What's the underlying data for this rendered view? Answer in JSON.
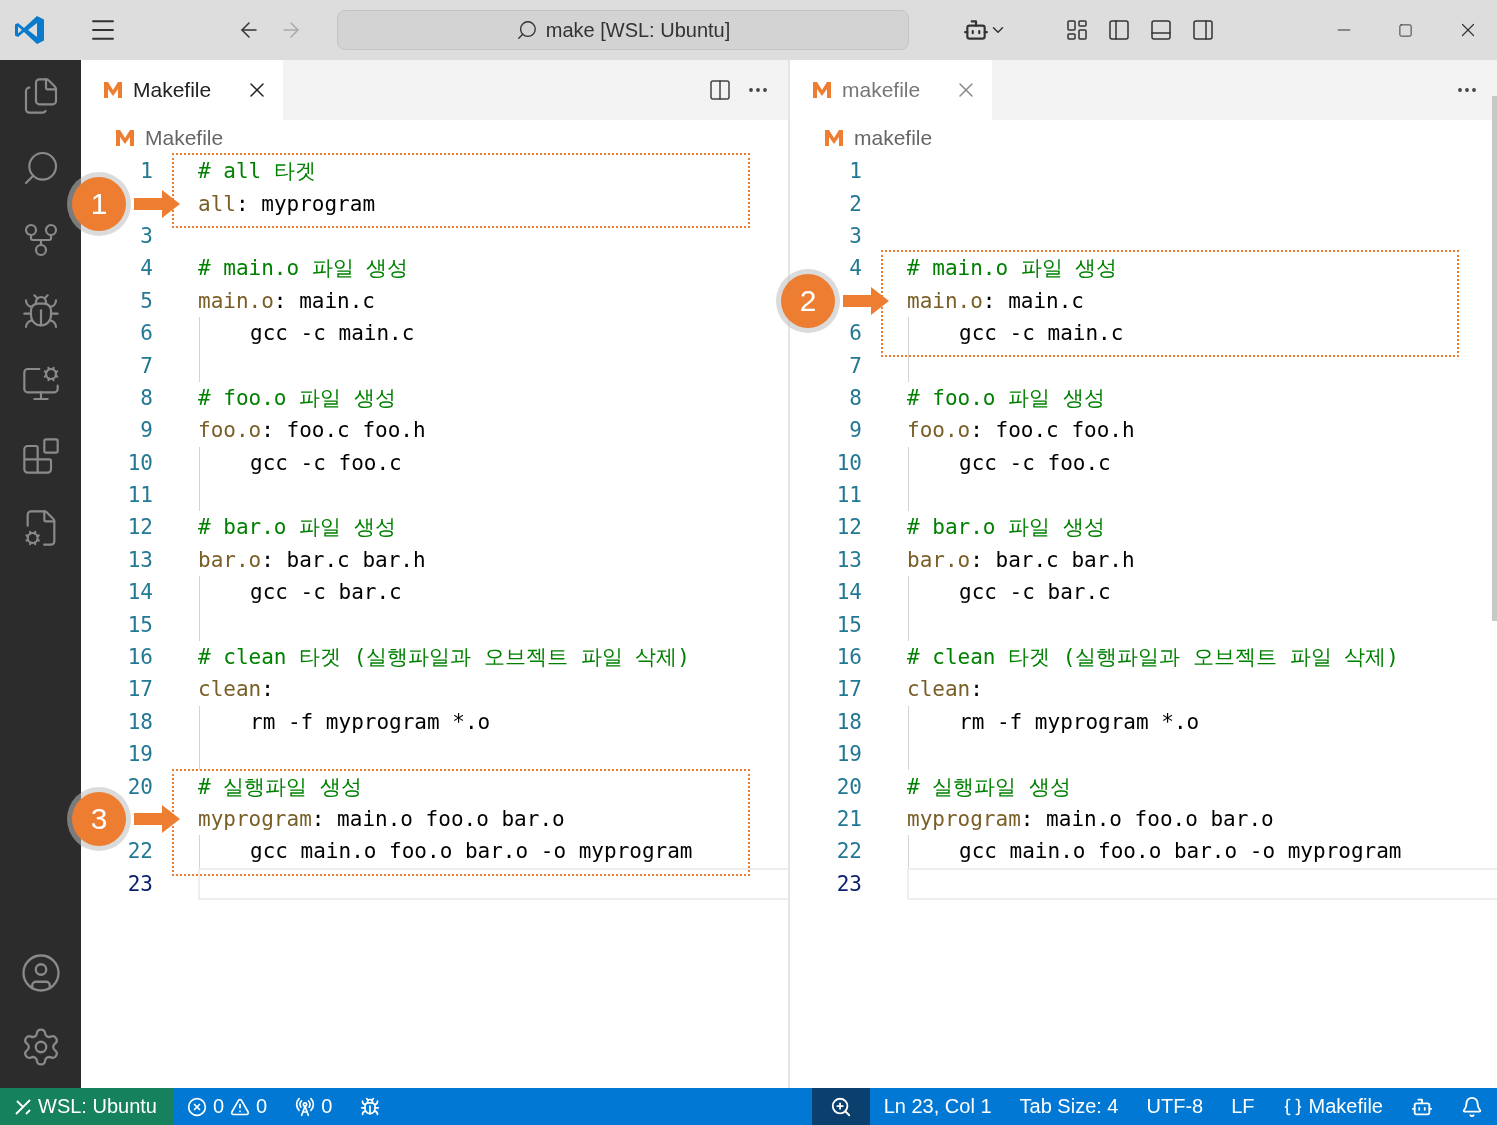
{
  "window": {
    "title": "make [WSL: Ubuntu]"
  },
  "panes": [
    {
      "focused": true,
      "tabs": [
        {
          "label": "Makefile",
          "selected": true
        }
      ],
      "breadcrumb": "Makefile",
      "split_button": true,
      "lines": [
        {
          "n": "1",
          "kind": "comment",
          "text": "# all 타겟",
          "boxed": true,
          "current": false
        },
        {
          "kind": "rule",
          "target": "all",
          "sep": ":",
          "deps": " myprogram",
          "boxed": true,
          "current": false,
          "marker": "1"
        },
        {
          "n": "3",
          "kind": "blank",
          "boxed": false,
          "current": false
        },
        {
          "n": "4",
          "kind": "comment",
          "text": "# main.o 파일 생성",
          "boxed": false,
          "current": false
        },
        {
          "n": "5",
          "kind": "rule",
          "target": "main.o",
          "sep": ":",
          "deps": " main.c",
          "boxed": false,
          "current": false
        },
        {
          "n": "6",
          "kind": "recipe",
          "text": "gcc -c main.c",
          "boxed": false,
          "current": false
        },
        {
          "n": "7",
          "kind": "blank",
          "boxed": false,
          "current": false
        },
        {
          "n": "8",
          "kind": "comment",
          "text": "# foo.o 파일 생성",
          "boxed": false,
          "current": false
        },
        {
          "n": "9",
          "kind": "rule",
          "target": "foo.o",
          "sep": ":",
          "deps": " foo.c foo.h",
          "boxed": false,
          "current": false
        },
        {
          "n": "10",
          "kind": "recipe",
          "text": "gcc -c foo.c",
          "boxed": false,
          "current": false
        },
        {
          "n": "11",
          "kind": "blank",
          "boxed": false,
          "current": false
        },
        {
          "n": "12",
          "kind": "comment",
          "text": "# bar.o 파일 생성",
          "boxed": false,
          "current": false
        },
        {
          "n": "13",
          "kind": "rule",
          "target": "bar.o",
          "sep": ":",
          "deps": " bar.c bar.h",
          "boxed": false,
          "current": false
        },
        {
          "n": "14",
          "kind": "recipe",
          "text": "gcc -c bar.c",
          "boxed": false,
          "current": false
        },
        {
          "n": "15",
          "kind": "blank",
          "boxed": false,
          "current": false
        },
        {
          "n": "16",
          "kind": "comment",
          "text": "# clean 타겟 (실행파일과 오브젝트 파일 삭제)",
          "boxed": false,
          "current": false
        },
        {
          "n": "17",
          "kind": "rule",
          "target": "clean",
          "sep": ":",
          "boxed": false,
          "current": false
        },
        {
          "n": "18",
          "kind": "recipe",
          "text": "rm -f myprogram *.o",
          "boxed": false,
          "current": false
        },
        {
          "n": "19",
          "kind": "blank",
          "boxed": false,
          "current": false
        },
        {
          "n": "20",
          "kind": "comment",
          "text": "# 실행파일 생성",
          "boxed": true,
          "current": false
        },
        {
          "kind": "rule",
          "target": "myprogram",
          "sep": ":",
          "deps": " main.o foo.o bar.o",
          "boxed": true,
          "current": false,
          "marker": "3"
        },
        {
          "n": "22",
          "kind": "recipe",
          "text": "gcc main.o foo.o bar.o -o myprogram",
          "boxed": true,
          "current": false
        },
        {
          "n": "23",
          "kind": "blank",
          "boxed": false,
          "current": true
        }
      ]
    },
    {
      "focused": false,
      "tabs": [
        {
          "label": "makefile",
          "selected": true
        }
      ],
      "breadcrumb": "makefile",
      "split_button": false,
      "lines": [
        {
          "n": "1",
          "kind": "blank",
          "boxed": false,
          "current": false
        },
        {
          "n": "2",
          "kind": "blank",
          "boxed": false,
          "current": false
        },
        {
          "n": "3",
          "kind": "blank",
          "boxed": false,
          "current": false
        },
        {
          "n": "4",
          "kind": "comment",
          "text": "# main.o 파일 생성",
          "boxed": true,
          "current": false
        },
        {
          "kind": "rule",
          "target": "main.o",
          "sep": ":",
          "deps": " main.c",
          "boxed": true,
          "current": false,
          "marker": "2"
        },
        {
          "n": "6",
          "kind": "recipe",
          "text": "gcc -c main.c",
          "boxed": true,
          "current": false
        },
        {
          "n": "7",
          "kind": "blank",
          "boxed": false,
          "current": false
        },
        {
          "n": "8",
          "kind": "comment",
          "text": "# foo.o 파일 생성",
          "boxed": false,
          "current": false
        },
        {
          "n": "9",
          "kind": "rule",
          "target": "foo.o",
          "sep": ":",
          "deps": " foo.c foo.h",
          "boxed": false,
          "current": false
        },
        {
          "n": "10",
          "kind": "recipe",
          "text": "gcc -c foo.c",
          "boxed": false,
          "current": false
        },
        {
          "n": "11",
          "kind": "blank",
          "boxed": false,
          "current": false
        },
        {
          "n": "12",
          "kind": "comment",
          "text": "# bar.o 파일 생성",
          "boxed": false,
          "current": false
        },
        {
          "n": "13",
          "kind": "rule",
          "target": "bar.o",
          "sep": ":",
          "deps": " bar.c bar.h",
          "boxed": false,
          "current": false
        },
        {
          "n": "14",
          "kind": "recipe",
          "text": "gcc -c bar.c",
          "boxed": false,
          "current": false
        },
        {
          "n": "15",
          "kind": "blank",
          "boxed": false,
          "current": false
        },
        {
          "n": "16",
          "kind": "comment",
          "text": "# clean 타겟 (실행파일과 오브젝트 파일 삭제)",
          "boxed": false,
          "current": false
        },
        {
          "n": "17",
          "kind": "rule",
          "target": "clean",
          "sep": ":",
          "boxed": false,
          "current": false
        },
        {
          "n": "18",
          "kind": "recipe",
          "text": "rm -f myprogram *.o",
          "boxed": false,
          "current": false
        },
        {
          "n": "19",
          "kind": "blank",
          "boxed": false,
          "current": false
        },
        {
          "n": "20",
          "kind": "comment",
          "text": "# 실행파일 생성",
          "boxed": false,
          "current": false
        },
        {
          "n": "21",
          "kind": "rule",
          "target": "myprogram",
          "sep": ":",
          "deps": " main.o foo.o bar.o",
          "boxed": false,
          "current": false
        },
        {
          "n": "22",
          "kind": "recipe",
          "text": "gcc main.o foo.o bar.o -o myprogram",
          "boxed": false,
          "current": false
        },
        {
          "n": "23",
          "kind": "blank",
          "boxed": false,
          "current": true
        }
      ]
    }
  ],
  "status_bar": {
    "left": [
      {
        "kind": "remote",
        "text": "WSL: Ubuntu"
      },
      {
        "kind": "problems",
        "errors": "0",
        "warnings": "0"
      },
      {
        "kind": "ports",
        "text": "0"
      },
      {
        "kind": "debug"
      }
    ],
    "right": [
      {
        "kind": "zoom"
      },
      {
        "kind": "text",
        "text": "Ln 23, Col 1"
      },
      {
        "kind": "text",
        "text": "Tab Size: 4"
      },
      {
        "kind": "text",
        "text": "UTF-8"
      },
      {
        "kind": "text",
        "text": "LF"
      },
      {
        "kind": "language",
        "text": "Makefile"
      },
      {
        "kind": "copilot"
      },
      {
        "kind": "bell"
      }
    ]
  }
}
